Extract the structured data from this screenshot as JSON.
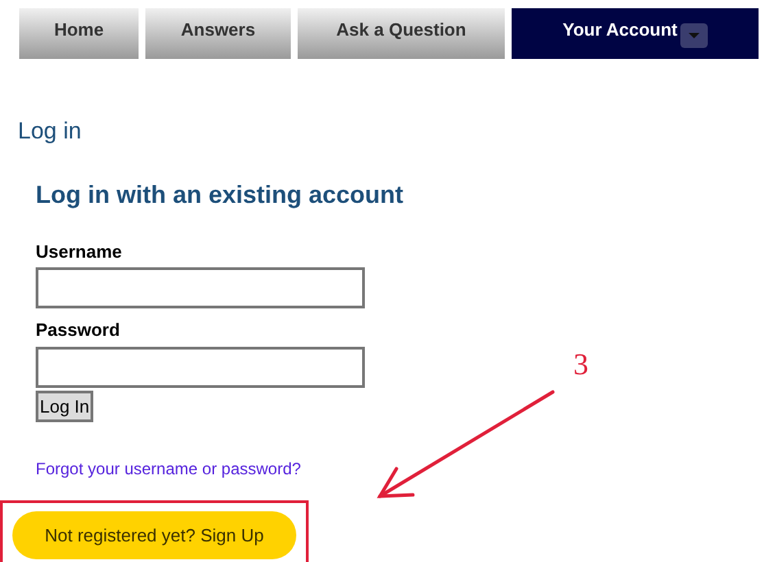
{
  "nav_tabs": [
    {
      "label": "Home",
      "selected": false,
      "has_dropdown": false
    },
    {
      "label": "Answers",
      "selected": false,
      "has_dropdown": false
    },
    {
      "label": "Ask a Question",
      "selected": false,
      "has_dropdown": false
    },
    {
      "label": "Your Account",
      "selected": true,
      "has_dropdown": true
    }
  ],
  "page_title": "Log in",
  "form": {
    "heading": "Log in with an existing account",
    "fields": [
      {
        "label": "Username"
      },
      {
        "label": "Password"
      }
    ],
    "submit": "Log In",
    "forgot_link": "Forgot your username or password?",
    "signup_button": "Not registered yet? Sign Up"
  },
  "annotation": {
    "label": "3"
  }
}
